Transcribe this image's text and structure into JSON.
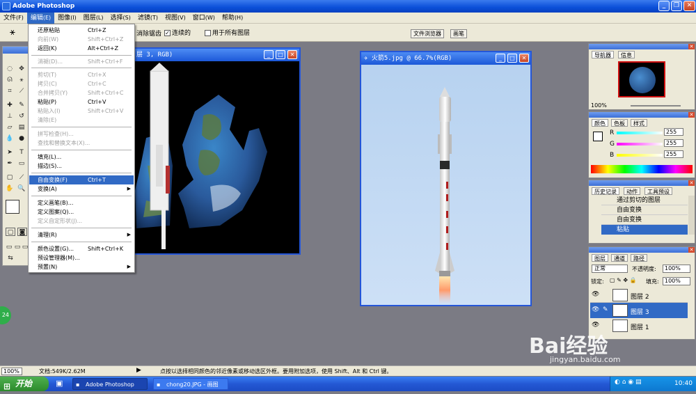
{
  "app": {
    "title": "Adobe Photoshop"
  },
  "menubar": [
    {
      "label": "文件",
      "key": "(F)"
    },
    {
      "label": "编辑",
      "key": "(E)"
    },
    {
      "label": "图像",
      "key": "(I)"
    },
    {
      "label": "图层",
      "key": "(L)"
    },
    {
      "label": "选择",
      "key": "(S)"
    },
    {
      "label": "滤镜",
      "key": "(T)"
    },
    {
      "label": "视图",
      "key": "(V)"
    },
    {
      "label": "窗口",
      "key": "(W)"
    },
    {
      "label": "帮助",
      "key": "(H)"
    }
  ],
  "options": {
    "antialias": "消除锯齿",
    "contiguous": "连续的",
    "all_layers": "用于所有图层",
    "file_browser": "文件浏览器",
    "brushes": "画笔"
  },
  "edit_menu": {
    "items": [
      {
        "label": "还原粘贴",
        "shortcut": "Ctrl+Z",
        "disabled": false
      },
      {
        "label": "向前(W)",
        "shortcut": "Shift+Ctrl+Z",
        "disabled": true
      },
      {
        "label": "返回(K)",
        "shortcut": "Alt+Ctrl+Z",
        "disabled": false
      },
      {
        "label": "消褪(D)...",
        "shortcut": "Shift+Ctrl+F",
        "disabled": true
      },
      {
        "label": "剪切(T)",
        "shortcut": "Ctrl+X",
        "disabled": true
      },
      {
        "label": "拷贝(C)",
        "shortcut": "Ctrl+C",
        "disabled": true
      },
      {
        "label": "合并拷贝(Y)",
        "shortcut": "Shift+Ctrl+C",
        "disabled": true
      },
      {
        "label": "粘贴(P)",
        "shortcut": "Ctrl+V",
        "disabled": false
      },
      {
        "label": "粘贴入(I)",
        "shortcut": "Shift+Ctrl+V",
        "disabled": true
      },
      {
        "label": "清除(E)",
        "shortcut": "",
        "disabled": true
      },
      {
        "label": "拼写检查(H)...",
        "shortcut": "",
        "disabled": true
      },
      {
        "label": "查找和替换文本(X)...",
        "shortcut": "",
        "disabled": true
      },
      {
        "label": "填充(L)...",
        "shortcut": "",
        "disabled": false
      },
      {
        "label": "描边(S)...",
        "shortcut": "",
        "disabled": false
      },
      {
        "label": "自由变换(F)",
        "shortcut": "Ctrl+T",
        "disabled": false,
        "highlighted": true
      },
      {
        "label": "变换(A)",
        "shortcut": "",
        "disabled": false,
        "submenu": true
      },
      {
        "label": "定义画笔(B)...",
        "shortcut": "",
        "disabled": false
      },
      {
        "label": "定义图案(Q)...",
        "shortcut": "",
        "disabled": false
      },
      {
        "label": "定义自定形状(J)...",
        "shortcut": "",
        "disabled": true
      },
      {
        "label": "清理(R)",
        "shortcut": "",
        "disabled": false,
        "submenu": true
      },
      {
        "label": "颜色设置(G)...",
        "shortcut": "Shift+Ctrl+K",
        "disabled": false
      },
      {
        "label": "预设管理器(M)...",
        "shortcut": "",
        "disabled": false
      },
      {
        "label": "预置(N)",
        "shortcut": "",
        "disabled": false,
        "submenu": true
      }
    ]
  },
  "doc1": {
    "title": "层 3, RGB)"
  },
  "doc2": {
    "title": "火箭5.jpg @ 66.7%(RGB)"
  },
  "navigator": {
    "tabs": [
      "导航器",
      "信息"
    ],
    "zoom": "100%"
  },
  "color": {
    "tabs": [
      "颜色",
      "色板",
      "样式"
    ],
    "channels": [
      {
        "label": "R",
        "value": "255"
      },
      {
        "label": "G",
        "value": "255"
      },
      {
        "label": "B",
        "value": "255"
      }
    ]
  },
  "history": {
    "tabs": [
      "历史记录",
      "动作",
      "工具预设"
    ],
    "items": [
      "通过剪切的图层",
      "自由变换",
      "自由变换",
      "粘贴"
    ]
  },
  "layers": {
    "tabs": [
      "图层",
      "通道",
      "路径"
    ],
    "blend_mode": "正常",
    "opacity_label": "不透明度:",
    "opacity": "100%",
    "lock_label": "锁定:",
    "fill_label": "填充:",
    "fill": "100%",
    "items": [
      "图层 2",
      "图层 3",
      "图层 1"
    ]
  },
  "status": {
    "zoom": "100%",
    "doc_size": "文档:549K/2.62M",
    "hint": "点按以选择相同颜色的邻近像素或移动选区外框。要用附加选项，使用 Shift、Alt 和 Ctrl 键。"
  },
  "taskbar": {
    "start": "开始",
    "tasks": [
      "Adobe Photoshop",
      "chong20.JPG - 画图"
    ],
    "clock": "10:40"
  },
  "watermark": {
    "brand": "Bai经验",
    "url": "jingyan.baidu.com"
  },
  "badge": "24"
}
